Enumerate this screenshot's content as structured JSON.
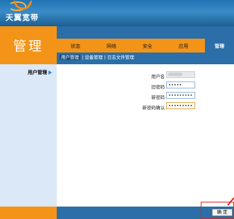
{
  "brand": {
    "logo_text": "天翼宽带"
  },
  "section": {
    "title": "管理"
  },
  "nav": {
    "items": [
      {
        "label": "状态"
      },
      {
        "label": "网络"
      },
      {
        "label": "安全"
      },
      {
        "label": "应用"
      }
    ],
    "active": "管理"
  },
  "subnav": {
    "items": [
      {
        "label": "用户管理"
      },
      {
        "label": "设备管理"
      },
      {
        "label": "日志文件管理"
      }
    ],
    "separator": "|"
  },
  "left_menu": {
    "item": "用户管理"
  },
  "form": {
    "username_label": "用户名",
    "old_password_label": "旧密码",
    "old_password_value": "•••••",
    "new_password_label": "新密码",
    "new_password_value": "•••••••••",
    "confirm_password_label": "新密码确认",
    "confirm_password_value": "•••••••••"
  },
  "footer": {
    "confirm_label": "确 定"
  },
  "colors": {
    "orange": "#f39418",
    "blue": "#2b6ea8",
    "highlight": "#e02020"
  }
}
